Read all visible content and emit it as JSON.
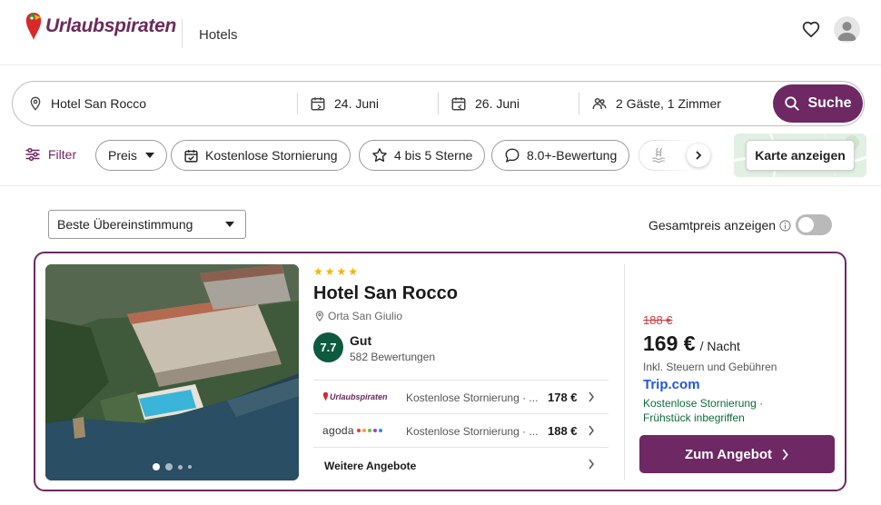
{
  "header": {
    "brand": "Urlaubspiraten",
    "nav_label": "Hotels"
  },
  "search": {
    "destination": "Hotel San Rocco",
    "checkin": "24. Juni",
    "checkout": "26. Juni",
    "guests": "2 Gäste, 1 Zimmer",
    "button_label": "Suche"
  },
  "filters": {
    "filter_label": "Filter",
    "chips": [
      "Preis",
      "Kostenlose Stornierung",
      "4 bis 5 Sterne",
      "8.0+-Bewertung"
    ],
    "map_button": "Karte anzeigen"
  },
  "sort": {
    "selected": "Beste Übereinstimmung",
    "total_price_label": "Gesamtpreis anzeigen",
    "total_price_on": false
  },
  "hotel": {
    "stars": 4,
    "name": "Hotel San Rocco",
    "location": "Orta San Giulio",
    "rating": "7.7",
    "rating_word": "Gut",
    "reviews": "582 Bewertungen",
    "offers": [
      {
        "provider": "Urlaubspiraten",
        "desc": "Kostenlose Stornierung · ...",
        "price": "178 €"
      },
      {
        "provider": "agoda",
        "desc": "Kostenlose Stornierung · ...",
        "price": "188 €"
      }
    ],
    "more_offers": "Weitere Angebote",
    "old_price": "188 €",
    "price": "169 €",
    "price_unit": "/ Nacht",
    "tax_note": "Inkl. Steuern und Gebühren",
    "deal_provider": "Trip",
    "deal_provider_suffix": ".com",
    "benefits": "Kostenlose Stornierung · Frühstück inbegriffen",
    "cta": "Zum Angebot",
    "photo_count": 4,
    "photo_active": 1
  },
  "colors": {
    "brand": "#6e2863",
    "rating": "#0d5a3f",
    "old_price": "#d23c3c",
    "benefit": "#0d6b3b",
    "trip": "#2458d6"
  }
}
